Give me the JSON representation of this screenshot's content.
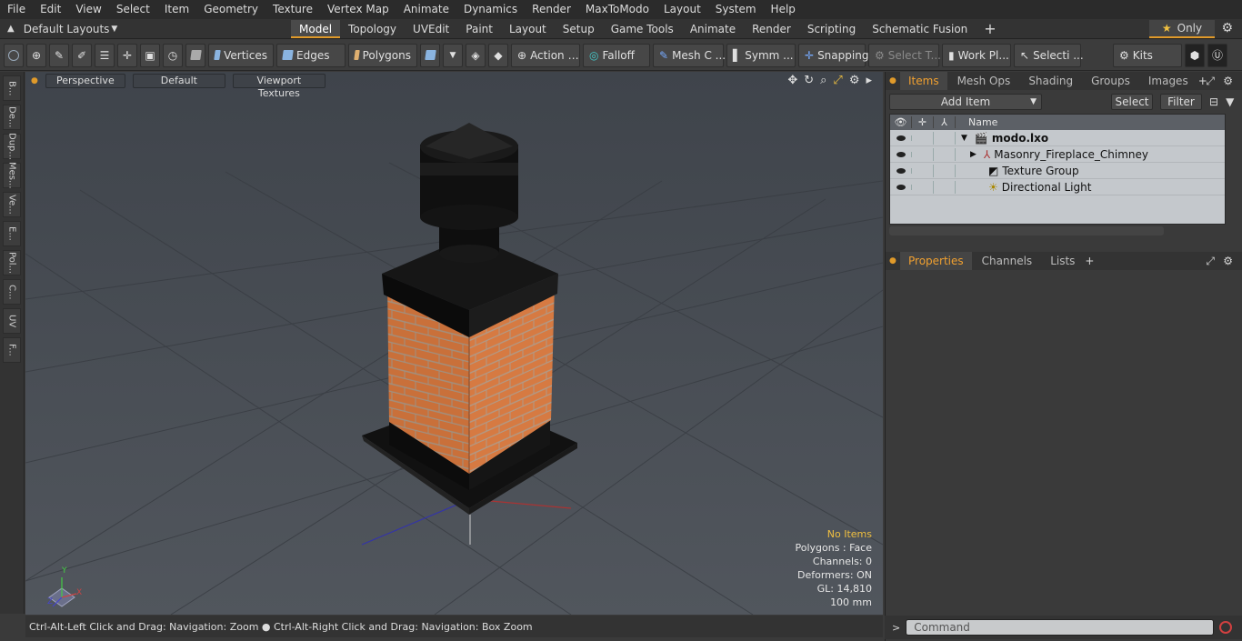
{
  "menu": [
    "File",
    "Edit",
    "View",
    "Select",
    "Item",
    "Geometry",
    "Texture",
    "Vertex Map",
    "Animate",
    "Dynamics",
    "Render",
    "MaxToModo",
    "Layout",
    "System",
    "Help"
  ],
  "layout": {
    "name": "Default Layouts",
    "only_label": "Only"
  },
  "tabs": [
    "Model",
    "Topology",
    "UVEdit",
    "Paint",
    "Layout",
    "Setup",
    "Game Tools",
    "Animate",
    "Render",
    "Scripting",
    "Schematic Fusion"
  ],
  "active_tab": "Model",
  "toolbar": {
    "vertices": "Vertices",
    "edges": "Edges",
    "polygons": "Polygons",
    "action": "Action",
    "falloff": "Falloff",
    "mesh": "Mesh C ...",
    "symm": "Symm ...",
    "snapping": "Snapping",
    "select_t": "Select T...",
    "workpl": "Work Pl...",
    "selecti": "Selecti ...",
    "kits": "Kits"
  },
  "left_tabs": [
    "B...",
    "De...",
    "Dup...",
    "Mes...",
    "Ve...",
    "E...",
    "Pol...",
    "C...",
    "UV",
    "F..."
  ],
  "viewport": {
    "perspective": "Perspective",
    "default": "Default",
    "textures": "Viewport Textures",
    "hud": [
      "No Items",
      "Polygons : Face",
      "Channels: 0",
      "Deformers: ON",
      "GL: 14,810",
      "100 mm"
    ],
    "axis_x": "X",
    "axis_y": "Y",
    "axis_z": "Z"
  },
  "status": "Ctrl-Alt-Left Click and Drag: Navigation: Zoom ● Ctrl-Alt-Right Click and Drag: Navigation: Box Zoom",
  "items_panel": {
    "tabs": [
      "Items",
      "Mesh Ops",
      "Shading",
      "Groups",
      "Images"
    ],
    "add_item": "Add Item",
    "select": "Select",
    "filter": "Filter",
    "name_col": "Name",
    "rows": [
      "modo.lxo",
      "Masonry_Fireplace_Chimney",
      "Texture Group",
      "Directional Light"
    ]
  },
  "props_panel": {
    "tabs": [
      "Properties",
      "Channels",
      "Lists"
    ]
  },
  "command": {
    "placeholder": "Command"
  }
}
